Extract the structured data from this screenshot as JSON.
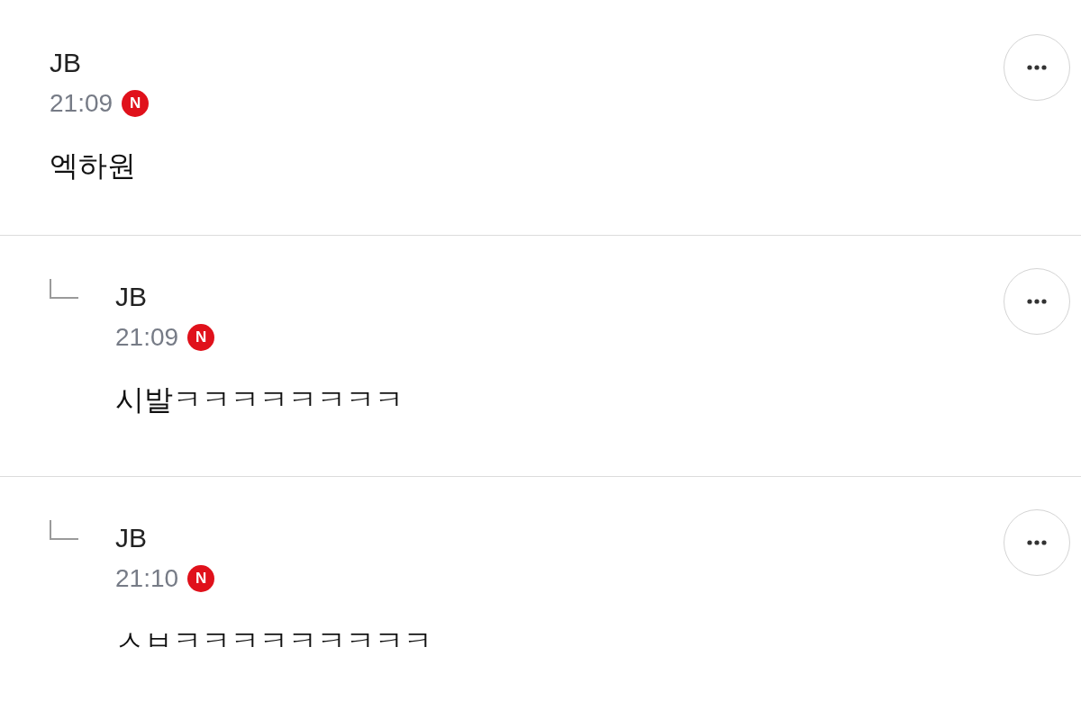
{
  "comments": [
    {
      "reply": false,
      "author": "JB",
      "time": "21:09",
      "badge": "N",
      "text": "엑하원"
    },
    {
      "reply": true,
      "author": "JB",
      "time": "21:09",
      "badge": "N",
      "text": "시발ㅋㅋㅋㅋㅋㅋㅋㅋ"
    },
    {
      "reply": true,
      "author": "JB",
      "time": "21:10",
      "badge": "N",
      "text": "ㅅㅂㅋㅋㅋㅋㅋㅋㅋㅋㅋ"
    }
  ]
}
